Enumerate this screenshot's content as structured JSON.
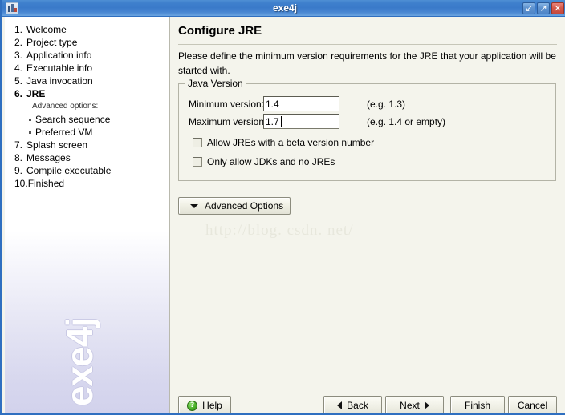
{
  "window": {
    "title": "exe4j",
    "icon": "application-icon",
    "buttons": [
      {
        "name": "minimize-button",
        "glyph": "↙"
      },
      {
        "name": "maximize-button",
        "glyph": "↗"
      },
      {
        "name": "close-button",
        "glyph": "✕"
      }
    ]
  },
  "sidebar": {
    "watermark": "exe4j",
    "steps": [
      {
        "num": "1.",
        "label": "Welcome",
        "current": false
      },
      {
        "num": "2.",
        "label": "Project type",
        "current": false
      },
      {
        "num": "3.",
        "label": "Application info",
        "current": false
      },
      {
        "num": "4.",
        "label": "Executable info",
        "current": false
      },
      {
        "num": "5.",
        "label": "Java invocation",
        "current": false
      },
      {
        "num": "6.",
        "label": "JRE",
        "current": true
      },
      {
        "num": "7.",
        "label": "Splash screen",
        "current": false
      },
      {
        "num": "8.",
        "label": "Messages",
        "current": false
      },
      {
        "num": "9.",
        "label": "Compile executable",
        "current": false
      },
      {
        "num": "10.",
        "label": "Finished",
        "current": false
      }
    ],
    "sub_header": "Advanced options:",
    "sub_items": [
      {
        "label": "Search sequence"
      },
      {
        "label": "Preferred VM"
      }
    ]
  },
  "main": {
    "title": "Configure JRE",
    "description": "Please define the minimum version requirements for the JRE that your application will be started with.",
    "group": {
      "label": "Java Version",
      "min_label": "Minimum version:",
      "min_value": "1.4",
      "min_hint": "(e.g. 1.3)",
      "max_label": "Maximum version:",
      "max_value": "1.7",
      "max_hint": "(e.g. 1.4 or empty)",
      "checkboxes": [
        {
          "label": "Allow JREs with a beta version number",
          "checked": false
        },
        {
          "label": "Only allow JDKs and no JREs",
          "checked": false
        }
      ]
    },
    "advanced_button": "Advanced Options",
    "watermark": "http://blog. csdn. net/"
  },
  "footer": {
    "help": "Help",
    "back": "Back",
    "next": "Next",
    "finish": "Finish",
    "cancel": "Cancel"
  }
}
